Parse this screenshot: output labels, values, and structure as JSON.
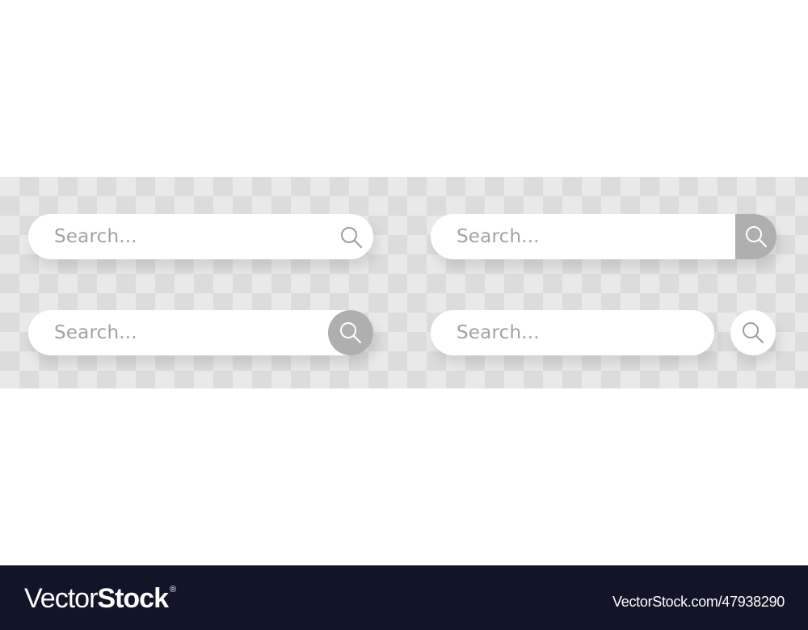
{
  "search_bars": [
    {
      "variant": "inline-icon",
      "placeholder": "Search...",
      "icon": "search-icon"
    },
    {
      "variant": "attached-square-button",
      "placeholder": "Search...",
      "icon": "search-icon",
      "button_color": "#afafaf"
    },
    {
      "variant": "overlapping-circle-button",
      "placeholder": "Search...",
      "icon": "search-icon",
      "button_color": "#afafaf"
    },
    {
      "variant": "separate-circle-button",
      "placeholder": "Search...",
      "icon": "search-icon",
      "button_color": "#ffffff"
    }
  ],
  "colors": {
    "placeholder_text": "#a2a2a2",
    "icon_gray": "#9e9e9e",
    "checker_light": "#e9e9ea",
    "checker_dark": "#dcdcdd",
    "footer_bg": "#121427"
  },
  "footer": {
    "logo_light": "Vector",
    "logo_bold": "Stock",
    "logo_mark": "®",
    "reference": "VectorStock.com/47938290"
  }
}
